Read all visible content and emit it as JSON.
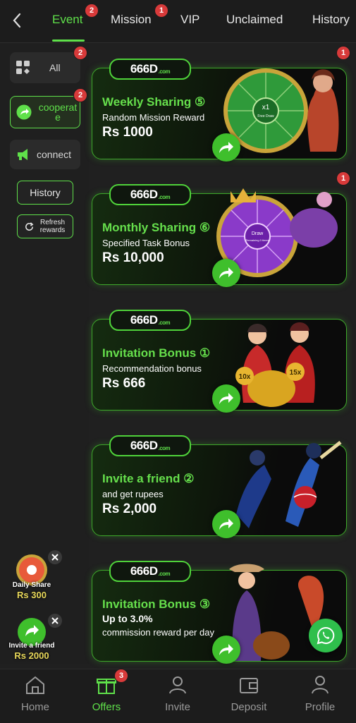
{
  "header": {
    "tabs": [
      {
        "label": "Event",
        "badge": "2"
      },
      {
        "label": "Mission",
        "badge": "1"
      },
      {
        "label": "VIP"
      },
      {
        "label": "Unclaimed"
      },
      {
        "label": "History"
      }
    ]
  },
  "sidebar": {
    "items": [
      {
        "label": "All",
        "badge": "2"
      },
      {
        "label": "cooperate",
        "badge": "2"
      },
      {
        "label": "connect"
      }
    ],
    "history_label": "History",
    "refresh_label": "Refresh rewards"
  },
  "cards": [
    {
      "logo": "666D",
      "logo_suffix": ".com",
      "title": "Weekly Sharing ⑤",
      "subtitle": "Random Mission Reward",
      "amount": "Rs 1000",
      "badge": "1",
      "wheel_center_1": "x1",
      "wheel_center_2": "Free Draw"
    },
    {
      "logo": "666D",
      "logo_suffix": ".com",
      "title": "Monthly Sharing ⑥",
      "subtitle": "Specified Task Bonus",
      "amount": "Rs 10,000",
      "badge": "1",
      "wheel_center_1": "Draw",
      "wheel_center_2": "Remaining 0 times"
    },
    {
      "logo": "666D",
      "logo_suffix": ".com",
      "title": "Invitation Bonus ①",
      "subtitle": "Recommendation bonus",
      "amount": "Rs 666",
      "chip1": "10x",
      "chip2": "15x"
    },
    {
      "logo": "666D",
      "logo_suffix": ".com",
      "title": "Invite a friend ②",
      "subtitle": "and get rupees",
      "amount": "Rs 2,000"
    },
    {
      "logo": "666D",
      "logo_suffix": ".com",
      "title": "Invitation Bonus ③",
      "subtitle_line1": "Up to 3.0%",
      "subtitle_line2": "commission reward per day"
    }
  ],
  "floaters": [
    {
      "label": "Daily Share",
      "amount": "Rs 300"
    },
    {
      "label": "Invite a friend",
      "amount": "Rs 2000"
    }
  ],
  "bottom_nav": {
    "items": [
      {
        "label": "Home"
      },
      {
        "label": "Offers",
        "badge": "3"
      },
      {
        "label": "Invite"
      },
      {
        "label": "Deposit"
      },
      {
        "label": "Profile"
      }
    ]
  },
  "colors": {
    "accent": "#5fe04a",
    "badge": "#d83a3a",
    "background": "#202020"
  }
}
